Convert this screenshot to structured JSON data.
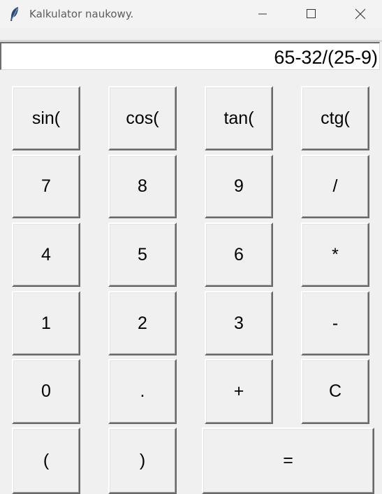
{
  "window": {
    "title": "Kalkulator naukowy.",
    "icon": "feather-icon",
    "controls": [
      "minimize-icon",
      "maximize-icon",
      "close-icon"
    ]
  },
  "display": {
    "value": "65-32/(25-9)"
  },
  "keys": {
    "sin": "sin(",
    "cos": "cos(",
    "tan": "tan(",
    "ctg": "ctg(",
    "seven": "7",
    "eight": "8",
    "nine": "9",
    "divide": "/",
    "four": "4",
    "five": "5",
    "six": "6",
    "multiply": "*",
    "one": "1",
    "two": "2",
    "three": "3",
    "minus": "-",
    "zero": "0",
    "dot": ".",
    "plus": "+",
    "clear": "C",
    "open_paren": "(",
    "close_paren": ")",
    "equals": "="
  }
}
